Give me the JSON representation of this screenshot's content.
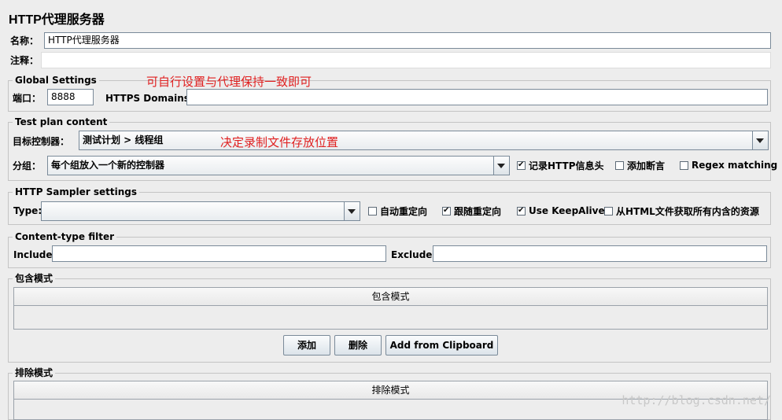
{
  "panel": {
    "title": "HTTP代理服务器"
  },
  "name": {
    "label": "名称：",
    "value": "HTTP代理服务器"
  },
  "comment": {
    "label": "注释：",
    "value": ""
  },
  "global_settings": {
    "legend": "Global Settings",
    "annotation": "可自行设置与代理保持一致即可",
    "port_label": "端口：",
    "port_value": "8888",
    "https_label": "HTTPS Domains :",
    "https_value": ""
  },
  "test_plan": {
    "legend": "Test plan content",
    "target_label": "目标控制器：",
    "target_value": "测试计划 > 线程组",
    "annotation": "决定录制文件存放位置",
    "grouping_label": "分组：",
    "grouping_value": "每个组放入一个新的控制器",
    "capture_headers": {
      "label": "记录HTTP信息头",
      "checked": true
    },
    "add_assertions": {
      "label": "添加断言",
      "checked": false
    },
    "regex_matching": {
      "label": "Regex matching",
      "checked": false
    }
  },
  "sampler": {
    "legend": "HTTP Sampler settings",
    "type_label": "Type:",
    "type_value": "",
    "auto_redirect": {
      "label": "自动重定向",
      "checked": false
    },
    "follow_redirect": {
      "label": "跟随重定向",
      "checked": true
    },
    "keepalive": {
      "label": "Use KeepAlive",
      "checked": true
    },
    "embedded": {
      "label": "从HTML文件获取所有内含的资源",
      "checked": false
    }
  },
  "content_type": {
    "legend": "Content-type filter",
    "include_label": "Include:",
    "include_value": "",
    "exclude_label": "Exclude:",
    "exclude_value": ""
  },
  "include_patterns": {
    "legend": "包含模式",
    "column": "包含模式",
    "add_button": "添加",
    "delete_button": "删除",
    "clipboard_button": "Add from Clipboard"
  },
  "exclude_patterns": {
    "legend": "排除模式",
    "column": "排除模式"
  },
  "watermark": "http://blog.csdn.net/"
}
